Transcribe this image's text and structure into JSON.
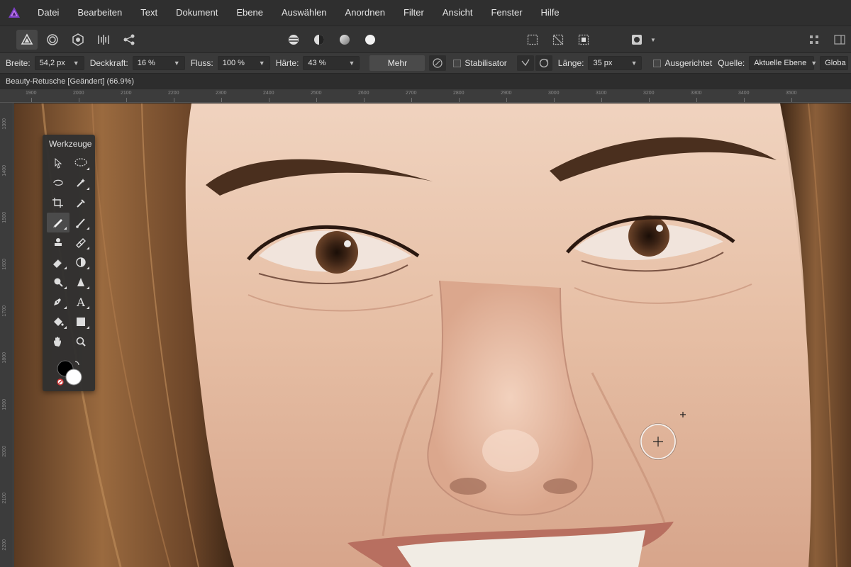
{
  "menu": {
    "logo_icon": "affinity-photo-logo-icon",
    "items": [
      {
        "label": "Datei"
      },
      {
        "label": "Bearbeiten"
      },
      {
        "label": "Text"
      },
      {
        "label": "Dokument"
      },
      {
        "label": "Ebene"
      },
      {
        "label": "Auswählen"
      },
      {
        "label": "Anordnen"
      },
      {
        "label": "Filter"
      },
      {
        "label": "Ansicht"
      },
      {
        "label": "Fenster"
      },
      {
        "label": "Hilfe"
      }
    ]
  },
  "context_bar": {
    "width_label": "Breite:",
    "width_value": "54,2 px",
    "opacity_label": "Deckkraft:",
    "opacity_value": "16 %",
    "flow_label": "Fluss:",
    "flow_value": "100 %",
    "hardness_label": "Härte:",
    "hardness_value": "43 %",
    "more_label": "Mehr",
    "stabilizer_label": "Stabilisator",
    "length_label": "Länge:",
    "length_value": "35 px",
    "aligned_label": "Ausgerichtet",
    "source_label": "Quelle:",
    "source_value": "Aktuelle Ebene",
    "global_label": "Globa"
  },
  "document": {
    "tab_title": "Beauty-Retusche [Geändert] (66.9%)"
  },
  "rulers": {
    "horizontal": [
      "1900",
      "2000",
      "2100",
      "2200",
      "2300",
      "2400",
      "2500",
      "2600",
      "2700",
      "2800",
      "2900",
      "3000",
      "3100",
      "3200",
      "3300",
      "3400",
      "3500"
    ],
    "vertical": [
      "1300",
      "1400",
      "1500",
      "1600",
      "1700",
      "1800",
      "1900",
      "2000",
      "2100",
      "2200"
    ]
  },
  "tools_panel": {
    "title": "Werkzeuge"
  },
  "colors": {
    "accent": "#9b59d6",
    "primary_color": "#000000",
    "secondary_color": "#ffffff"
  }
}
